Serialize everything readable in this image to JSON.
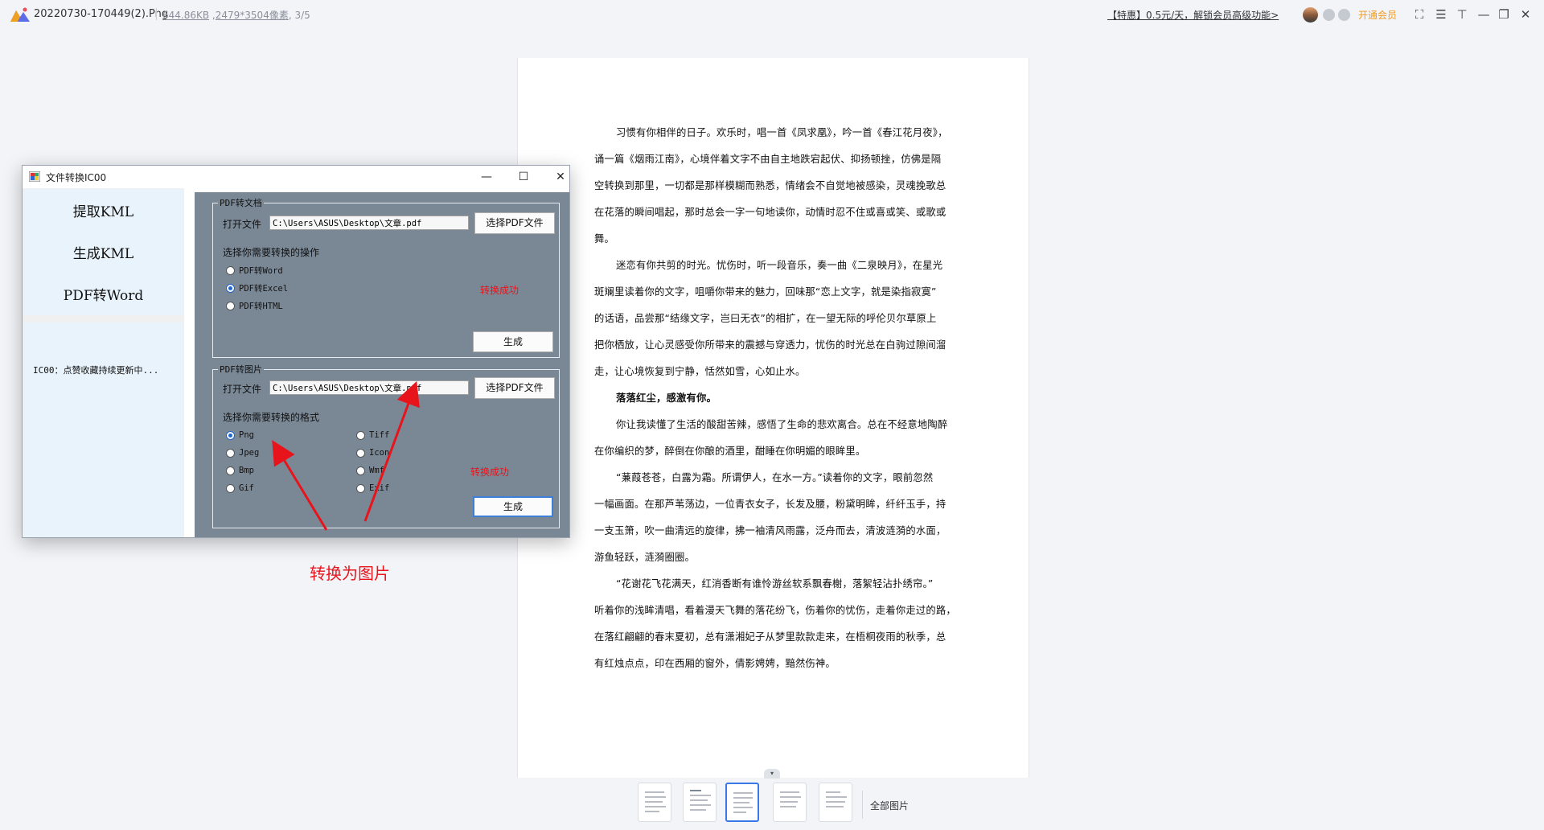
{
  "topbar": {
    "filename": "20220730-170449(2).Png",
    "filesize": "644.86KB",
    "dimensions": "2479*3504像素",
    "page_index": "3/5",
    "promo": "【特惠】0.5元/天，解锁会员高级功能>",
    "vip_label": "开通会员",
    "controls": [
      "fullscreen-icon",
      "menu-icon",
      "pin-icon",
      "minimize-icon",
      "restore-icon",
      "close-icon"
    ]
  },
  "document": {
    "paragraphs": [
      "习惯有你相伴的日子。欢乐时，唱一首《凤求凰》，吟一首《春江花月夜》，",
      "诵一篇《烟雨江南》，心境伴着文字不由自主地跌宕起伏、抑扬顿挫，仿佛是隔",
      "空转换到那里，一切都是那样模糊而熟悉，情绪会不自觉地被感染，灵魂挽歌总",
      "在花落的瞬间唱起，那时总会一字一句地读你，动情时忍不住或喜或笑、或歌或",
      "舞。",
      "迷恋有你共剪的时光。忧伤时，听一段音乐，奏一曲《二泉映月》，在星光",
      "斑斓里读着你的文字，咀嚼你带来的魅力，回味那“恋上文字，就是染指寂寞”",
      "的话语，品尝那“结缘文字，岂曰无衣”的相扩，在一望无际的呼伦贝尔草原上",
      "把你栖放，让心灵感受你所带来的震撼与穿透力，忧伤的时光总在白驹过隙间溜",
      "走，让心境恢复到宁静，恬然如雪，心如止水。",
      "落落红尘，感激有你。",
      "你让我读懂了生活的酸甜苦辣，感悟了生命的悲欢离合。总在不经意地陶醉",
      "在你编织的梦，醉倒在你酿的酒里，酣睡在你明媚的眼眸里。",
      "“蒹葭苍苍，白露为霜。所谓伊人，在水一方。”读着你的文字，眼前忽然",
      "一幅画面。在那芦苇荡边，一位青衣女子，长发及腰，粉黛明眸，纤纤玉手，持",
      "一支玉箫，吹一曲清远的旋律，拂一袖清风雨露，泛舟而去，清波涟漪的水面，",
      "游鱼轻跃，涟漪圈圈。",
      "“花谢花飞花满天，红消香断有谁怜游丝软系飘春榭，落絮轻沾扑绣帘。”",
      "听着你的浅眸清唱，看着漫天飞舞的落花纷飞，伤着你的忧伤，走着你走过的路，",
      "在落红翩翩的春末夏初，总有潇湘妃子从梦里款款走来，在梧桐夜雨的秋季，总",
      "有红烛点点，印在西厢的窗外，倩影娉娉，黯然伤神。"
    ]
  },
  "app": {
    "title": "文件转换IC00",
    "menu": [
      "提取KML",
      "生成KML",
      "PDF转Word"
    ],
    "info_text": "IC00：点赞收藏持续更新中...",
    "pdf_doc": {
      "legend": "PDF转文档",
      "open_label": "打开文件",
      "path": "C:\\Users\\ASUS\\Desktop\\文章.pdf",
      "select_button": "选择PDF文件",
      "op_label": "选择你需要转换的操作",
      "options": [
        "PDF转Word",
        "PDF转Excel",
        "PDF转HTML"
      ],
      "selected": "PDF转Excel",
      "status": "转换成功",
      "generate_button": "生成"
    },
    "pdf_img": {
      "legend": "PDF转图片",
      "open_label": "打开文件",
      "path": "C:\\Users\\ASUS\\Desktop\\文章.pdf",
      "select_button": "选择PDF文件",
      "fmt_label": "选择你需要转换的格式",
      "options_left": [
        "Png",
        "Jpeg",
        "Bmp",
        "Gif"
      ],
      "options_right": [
        "Tiff",
        "Icon",
        "Wmf",
        "Exif"
      ],
      "selected": "Png",
      "status": "转换成功",
      "generate_button": "生成"
    }
  },
  "annotation": {
    "text": "转换为图片",
    "color": "#e8141c"
  },
  "thumbnails": {
    "count": 5,
    "selected_index": 3,
    "all_label": "全部图片"
  },
  "colors": {
    "accent": "#3a78e8",
    "vip": "#f39a1d",
    "panel": "#7a8896"
  }
}
